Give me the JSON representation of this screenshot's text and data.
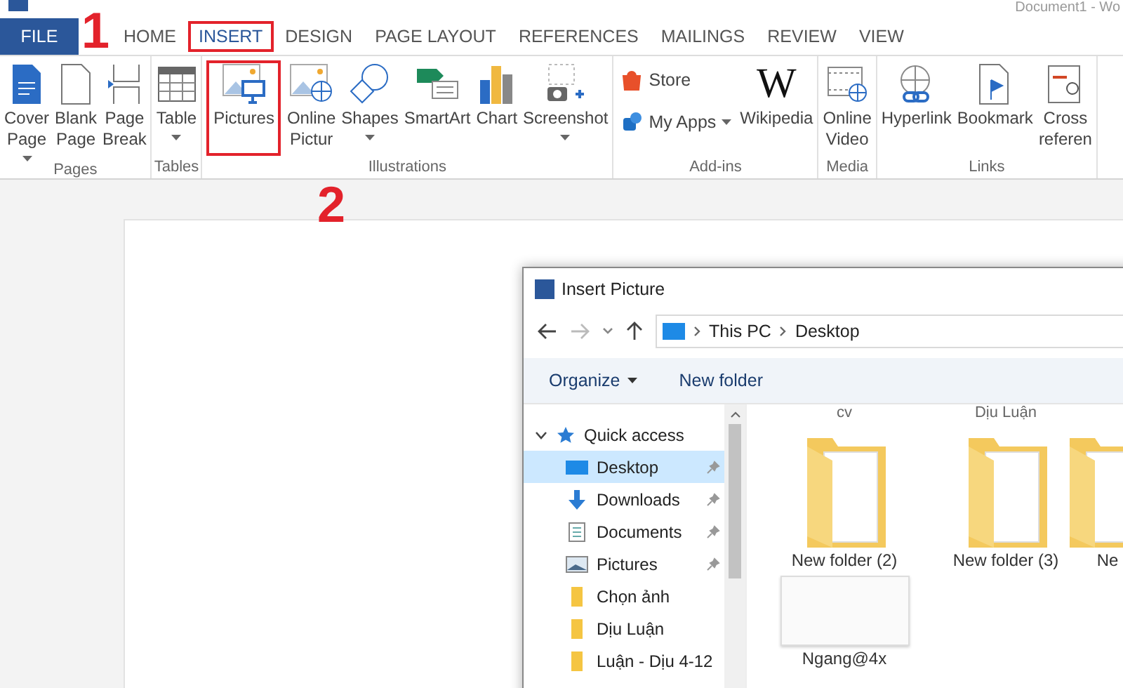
{
  "window": {
    "title": "Document1 - Wo"
  },
  "tabs": [
    {
      "label": "FILE",
      "kind": "file",
      "selected": false,
      "highlighted": false
    },
    {
      "label": "HOME",
      "kind": "tab",
      "selected": false,
      "highlighted": false
    },
    {
      "label": "INSERT",
      "kind": "tab",
      "selected": true,
      "highlighted": true
    },
    {
      "label": "DESIGN",
      "kind": "tab",
      "selected": false,
      "highlighted": false
    },
    {
      "label": "PAGE LAYOUT",
      "kind": "tab",
      "selected": false,
      "highlighted": false
    },
    {
      "label": "REFERENCES",
      "kind": "tab",
      "selected": false,
      "highlighted": false
    },
    {
      "label": "MAILINGS",
      "kind": "tab",
      "selected": false,
      "highlighted": false
    },
    {
      "label": "REVIEW",
      "kind": "tab",
      "selected": false,
      "highlighted": false
    },
    {
      "label": "VIEW",
      "kind": "tab",
      "selected": false,
      "highlighted": false
    }
  ],
  "ribbon": [
    {
      "label": "Pages",
      "buttons": [
        {
          "kind": "large",
          "lines": [
            "Cover",
            "Page"
          ],
          "dropdown": true,
          "highlighted": false
        },
        {
          "kind": "large",
          "lines": [
            "Blank",
            "Page"
          ],
          "dropdown": false,
          "highlighted": false
        },
        {
          "kind": "large",
          "lines": [
            "Page",
            "Break"
          ],
          "dropdown": false,
          "highlighted": false
        }
      ]
    },
    {
      "label": "Tables",
      "buttons": [
        {
          "kind": "large",
          "lines": [
            "Table"
          ],
          "dropdown": true,
          "highlighted": false
        }
      ]
    },
    {
      "label": "Illustrations",
      "buttons": [
        {
          "kind": "large",
          "lines": [
            "Pictures"
          ],
          "dropdown": false,
          "highlighted": true
        },
        {
          "kind": "large",
          "lines": [
            "Online",
            "Pictur"
          ],
          "dropdown": false,
          "highlighted": false
        },
        {
          "kind": "large",
          "lines": [
            "Shapes"
          ],
          "dropdown": true,
          "highlighted": false
        },
        {
          "kind": "large",
          "lines": [
            "SmartArt"
          ],
          "dropdown": false,
          "highlighted": false
        },
        {
          "kind": "large",
          "lines": [
            "Chart"
          ],
          "dropdown": false,
          "highlighted": false
        },
        {
          "kind": "large",
          "lines": [
            "Screenshot"
          ],
          "dropdown": true,
          "highlighted": false
        }
      ]
    },
    {
      "label": "Add-ins",
      "buttons": [
        {
          "kind": "small",
          "lines": [
            "Store"
          ],
          "dropdown": false,
          "highlighted": false
        },
        {
          "kind": "small",
          "lines": [
            "My Apps"
          ],
          "dropdown": true,
          "highlighted": false
        },
        {
          "kind": "large",
          "lines": [
            "Wikipedia"
          ],
          "glyph": "W",
          "dropdown": false,
          "highlighted": false
        }
      ]
    },
    {
      "label": "Media",
      "buttons": [
        {
          "kind": "large",
          "lines": [
            "Online",
            "Video"
          ],
          "dropdown": false,
          "highlighted": false
        }
      ]
    },
    {
      "label": "Links",
      "buttons": [
        {
          "kind": "large",
          "lines": [
            "Hyperlink"
          ],
          "dropdown": false,
          "highlighted": false
        },
        {
          "kind": "large",
          "lines": [
            "Bookmark"
          ],
          "dropdown": false,
          "highlighted": false
        },
        {
          "kind": "large",
          "lines": [
            "Cross",
            "referen"
          ],
          "dropdown": false,
          "highlighted": false
        }
      ]
    }
  ],
  "annotations": [
    {
      "label": "1"
    },
    {
      "label": "2"
    }
  ],
  "dialog": {
    "title": "Insert Picture",
    "breadcrumb": [
      "This PC",
      "Desktop"
    ],
    "toolbar": [
      {
        "label": "Organize",
        "dropdown": true
      },
      {
        "label": "New folder",
        "dropdown": false
      }
    ],
    "nav": [
      {
        "label": "Quick access",
        "expanded": true,
        "children": [
          {
            "label": "Desktop",
            "pinned": true,
            "selected": true
          },
          {
            "label": "Downloads",
            "pinned": true,
            "selected": false
          },
          {
            "label": "Documents",
            "pinned": true,
            "selected": false
          },
          {
            "label": "Pictures",
            "pinned": true,
            "selected": false
          },
          {
            "label": "Chọn ảnh",
            "pinned": false,
            "selected": false
          },
          {
            "label": "Dịu Luận",
            "pinned": false,
            "selected": false
          },
          {
            "label": "Luận - Dịu 4-12",
            "pinned": false,
            "selected": false
          }
        ]
      }
    ],
    "top_labels": [
      "cv",
      "Dịu Luận"
    ],
    "items": [
      {
        "kind": "folder",
        "label": "New folder (2)"
      },
      {
        "kind": "folder",
        "label": "New folder (3)"
      },
      {
        "kind": "folder",
        "label": "Ne"
      },
      {
        "kind": "image",
        "label": "Ngang@4x"
      }
    ]
  }
}
